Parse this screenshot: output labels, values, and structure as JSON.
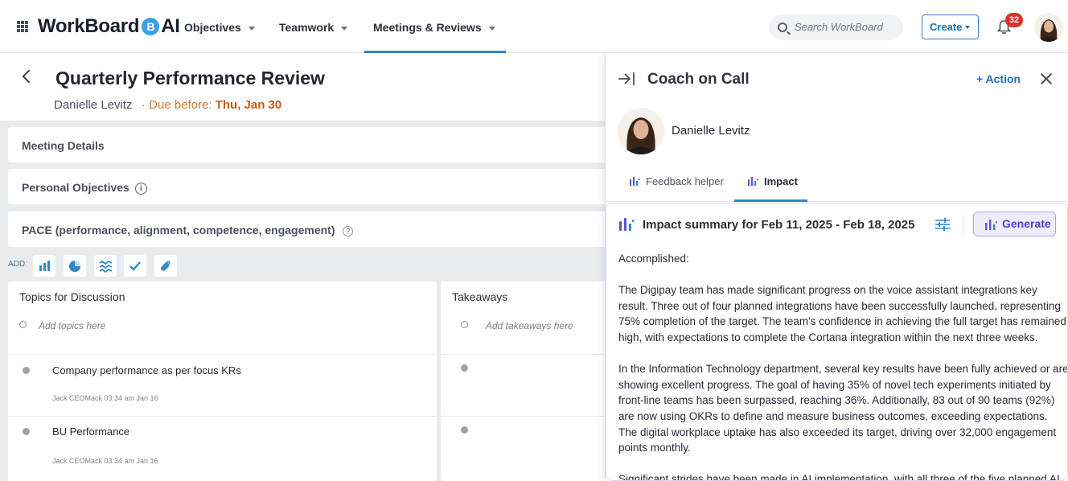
{
  "app": {
    "logo_text": "WorkBoard",
    "logo_badge": "B",
    "logo_suffix": "AI"
  },
  "nav": {
    "items": [
      {
        "label": "Objectives"
      },
      {
        "label": "Teamwork"
      },
      {
        "label": "Meetings & Reviews",
        "active": true
      }
    ],
    "search_placeholder": "Search WorkBoard",
    "create_label": "Create",
    "notification_count": "32"
  },
  "page": {
    "title": "Quarterly Performance Review",
    "owner": "Danielle Levitz",
    "due_prefix": "· Due before: ",
    "due_date": "Thu, Jan 30"
  },
  "sections": [
    {
      "label": "Meeting Details"
    },
    {
      "label": "Personal Objectives"
    },
    {
      "label": "PACE (performance, alignment, competence, engagement)"
    }
  ],
  "add_bar": {
    "label": "ADD:",
    "icons": [
      "bar-chart-icon",
      "pie-chart-icon",
      "waves-icon",
      "check-icon",
      "attachment-icon"
    ]
  },
  "topics": {
    "title": "Topics for Discussion",
    "add_placeholder": "Add topics here",
    "items": [
      {
        "text": "Company performance as per focus KRs",
        "meta": "Jack CEOMack   03:34 am Jan 16"
      },
      {
        "text": "BU Performance",
        "meta": "Jack CEOMack   03:34 am Jan 16"
      }
    ]
  },
  "takeaways": {
    "title": "Takeaways",
    "add_placeholder": "Add takeaways here"
  },
  "coach": {
    "title": "Coach on Call",
    "action_label": "+ Action",
    "person_name": "Danielle Levitz",
    "tabs": [
      {
        "label": "Feedback helper"
      },
      {
        "label": "Impact",
        "active": true
      }
    ],
    "summary_title": "Impact summary for Feb 11, 2025 - Feb 18, 2025",
    "generate_label": "Generate",
    "summary_paragraphs": [
      "Accomplished:",
      "The Digipay team has made significant progress on the voice assistant integrations key result. Three out of four planned integrations have been successfully launched, representing 75% completion of the target. The team's confidence in achieving the full target has remained high, with expectations to complete the Cortana integration within the next three weeks.",
      "In the Information Technology department, several key results have been fully achieved or are showing excellent progress. The goal of having 35% of novel tech experiments initiated by front-line teams has been surpassed, reaching 36%. Additionally, 83 out of 90 teams (92%) are now using OKRs to define and measure business outcomes, exceeding expectations. The digital workplace uptake has also exceeded its target, driving over 32,000 engagement points monthly.",
      "Significant strides have been made in AI implementation, with all three of the five planned AI"
    ]
  },
  "colors": {
    "accent_blue": "#2f87c8",
    "due_orange": "#c35b12",
    "generate_purple": "#4a3ec9",
    "badge_red": "#d5352b"
  }
}
